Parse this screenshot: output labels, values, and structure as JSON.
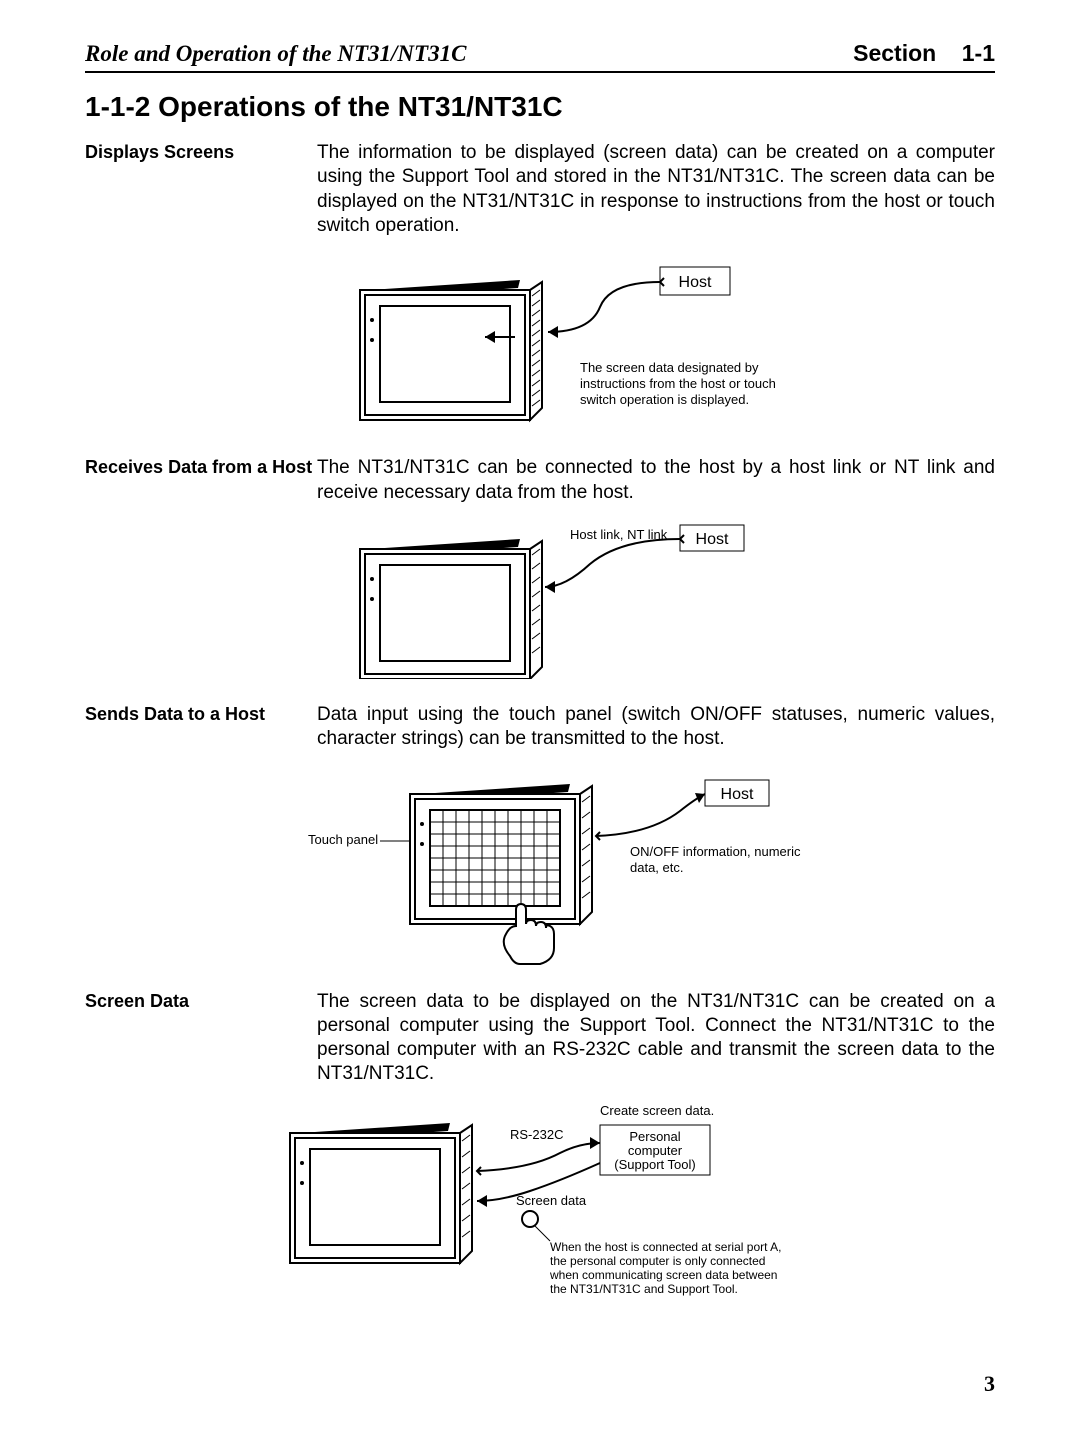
{
  "header": {
    "left": "Role and Operation of the NT31/NT31C",
    "right_section": "Section",
    "right_number": "1-1"
  },
  "heading": "1-1-2  Operations of the NT31/NT31C",
  "sections": [
    {
      "label": "Displays Screens",
      "body": "The information to be displayed (screen data) can be created on a computer using the Support Tool and stored in the NT31/NT31C. The screen data can be displayed on the NT31/NT31C in response to instructions from the host or touch switch operation.",
      "figure": {
        "host_label": "Host",
        "caption": "The screen data designated by instructions from the host or touch switch operation is displayed."
      }
    },
    {
      "label": "Receives Data from a Host",
      "body": "The NT31/NT31C can be connected to the host by a host link or NT link and receive necessary data from the host.",
      "figure": {
        "host_label": "Host",
        "link_label": "Host link, NT link"
      }
    },
    {
      "label": "Sends Data to a Host",
      "body": "Data input using the touch panel (switch ON/OFF statuses, numeric values, character strings) can be transmitted to the host.",
      "figure": {
        "host_label": "Host",
        "touch_label": "Touch panel",
        "caption": "ON/OFF information, numeric data, etc."
      }
    },
    {
      "label": "Screen Data",
      "body": "The screen data to be displayed on the NT31/NT31C can be created on a personal computer using the Support Tool. Connect the NT31/NT31C to the personal computer with an RS-232C cable and transmit the screen data to the NT31/NT31C.",
      "figure": {
        "pc_labels": [
          "Personal",
          "computer",
          "(Support Tool)"
        ],
        "rs232c": "RS-232C",
        "screen_data": "Screen data",
        "create": "Create screen data.",
        "caption_lines": [
          "When the host is connected at serial port A,",
          "the personal computer is only connected",
          "when communicating screen data between",
          "the NT31/NT31C and Support Tool."
        ]
      }
    }
  ],
  "page_number": "3"
}
